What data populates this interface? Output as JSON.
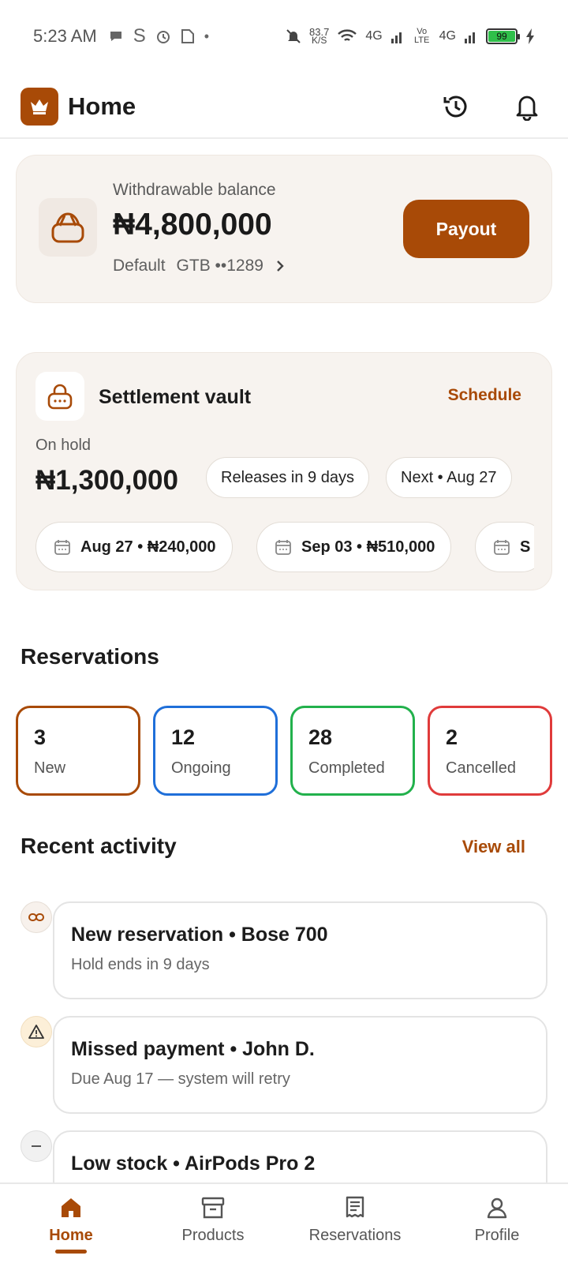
{
  "status_bar": {
    "time": "5:23 AM",
    "net_speed_value": "83.7",
    "net_speed_unit": "K/S",
    "signal_1": "4G",
    "volte": "Vo LTE",
    "signal_2": "4G",
    "battery": "99",
    "icons": [
      "chat-icon",
      "s-icon",
      "alarm-icon",
      "sim-icon",
      "dot-icon",
      "bell-muted-icon",
      "wifi-icon",
      "signal-icon",
      "charging-icon"
    ]
  },
  "header": {
    "title": "Home",
    "icons": [
      "crown-icon",
      "history-icon",
      "bell-icon"
    ]
  },
  "balance": {
    "label": "Withdrawable balance",
    "amount": "₦4,800,000",
    "default_label": "Default",
    "account": "GTB ••1289",
    "payout_label": "Payout"
  },
  "vault": {
    "title": "Settlement vault",
    "schedule_label": "Schedule",
    "onhold_label": "On hold",
    "onhold_amount": "₦1,300,000",
    "releases_pill": "Releases in 9 days",
    "next_pill": "Next • Aug 27",
    "dates": [
      {
        "label": "Aug 27 • ₦240,000"
      },
      {
        "label": "Sep 03 • ₦510,000"
      },
      {
        "label": "S"
      }
    ]
  },
  "reservations": {
    "title": "Reservations",
    "items": [
      {
        "count": "3",
        "label": "New",
        "color": "#a84a07"
      },
      {
        "count": "12",
        "label": "Ongoing",
        "color": "#1f6fd9"
      },
      {
        "count": "28",
        "label": "Completed",
        "color": "#22b14c"
      },
      {
        "count": "2",
        "label": "Cancelled",
        "color": "#e03b3b"
      }
    ]
  },
  "activity": {
    "title": "Recent activity",
    "view_all": "View all",
    "items": [
      {
        "title": "New reservation • Bose 700",
        "subtitle": "Hold ends in 9 days",
        "icon": "link-icon"
      },
      {
        "title": "Missed payment • John D.",
        "subtitle": "Due Aug 17 — system will retry",
        "icon": "warning-icon"
      },
      {
        "title": "Low stock • AirPods Pro 2",
        "subtitle": "",
        "icon": "minus-icon"
      }
    ]
  },
  "nav": {
    "items": [
      {
        "label": "Home",
        "icon": "home-icon"
      },
      {
        "label": "Products",
        "icon": "box-icon"
      },
      {
        "label": "Reservations",
        "icon": "receipt-icon"
      },
      {
        "label": "Profile",
        "icon": "person-icon"
      }
    ],
    "active": "Home"
  },
  "colors": {
    "accent": "#a84a07",
    "card_bg": "#f7f3ef"
  }
}
